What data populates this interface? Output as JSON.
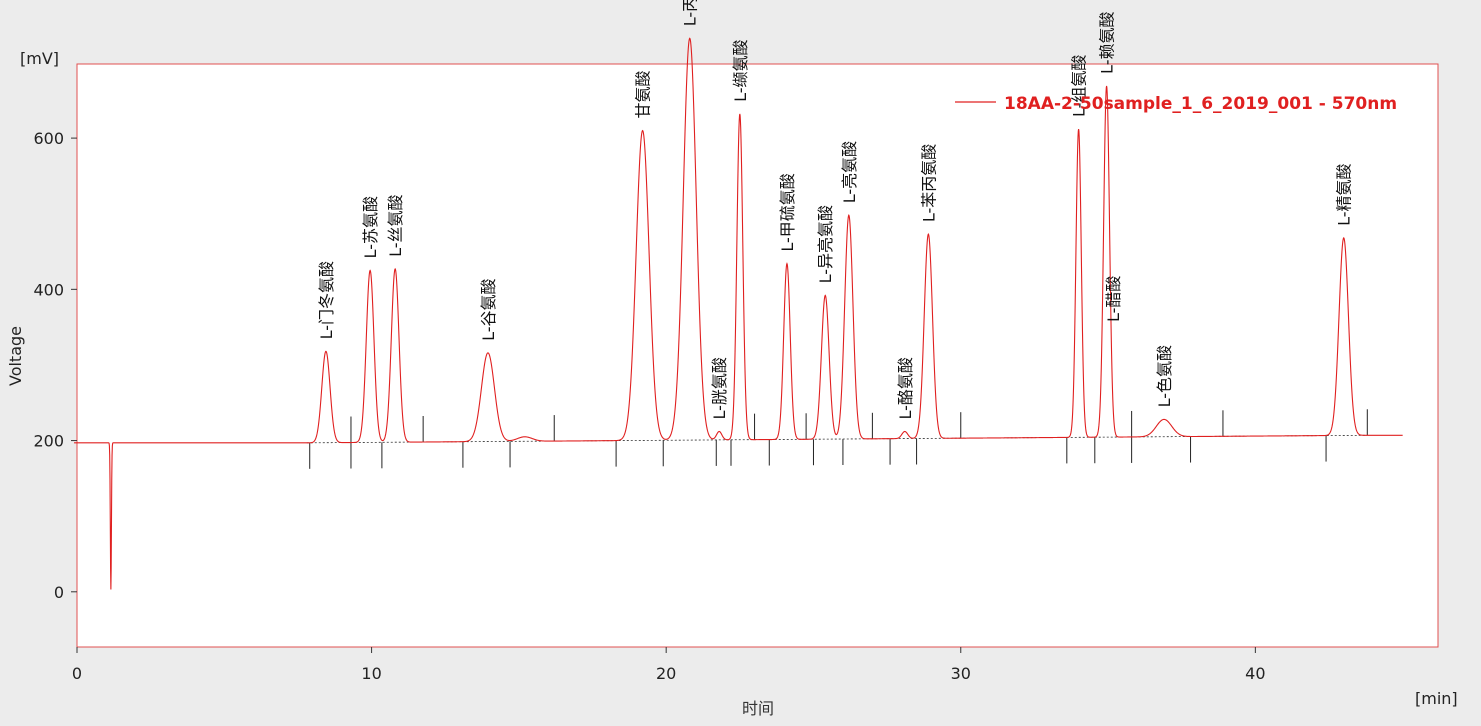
{
  "chart_data": {
    "type": "line",
    "y_unit": "[mV]",
    "ylabel": "Voltage",
    "x_unit": "[min]",
    "xlabel": "时间",
    "xlim": [
      0,
      46.2
    ],
    "ylim": [
      -73,
      698
    ],
    "x_ticks": [
      0,
      10,
      20,
      30,
      40
    ],
    "y_ticks": [
      0,
      200,
      400,
      600
    ],
    "legend_position": "top-right",
    "colors": {
      "trace": "#e02020",
      "frame": "#e05050",
      "baseline": "#333333"
    },
    "baseline": {
      "start": 197,
      "end": 207,
      "x_start": 7.8,
      "x_end": 43.8
    },
    "series": [
      {
        "name": "18AA-2-50sample_1_6_2019_001 - 570nm",
        "x_start": -0.1,
        "x_end": 45
      }
    ],
    "dip": {
      "x": 1.15,
      "y": 3
    },
    "peaks": [
      {
        "label": "L-门冬氨酸",
        "rt": 8.45,
        "height": 318,
        "sigma": 0.14
      },
      {
        "label": "L-苏氨酸",
        "rt": 9.95,
        "height": 425,
        "sigma": 0.13
      },
      {
        "label": "L-丝氨酸",
        "rt": 10.8,
        "height": 427,
        "sigma": 0.13
      },
      {
        "label": "L-谷氨酸",
        "rt": 13.95,
        "height": 316,
        "sigma": 0.22
      },
      {
        "label": "",
        "rt": 15.2,
        "height": 205,
        "sigma": 0.25
      },
      {
        "label": "甘氨酸",
        "rt": 19.2,
        "height": 610,
        "sigma": 0.22
      },
      {
        "label": "L-丙氨酸",
        "rt": 20.8,
        "height": 732,
        "sigma": 0.22
      },
      {
        "label": "L-胱氨酸",
        "rt": 21.8,
        "height": 212,
        "sigma": 0.09
      },
      {
        "label": "L-缬氨酸",
        "rt": 22.5,
        "height": 632,
        "sigma": 0.1
      },
      {
        "label": "L-甲硫氨酸",
        "rt": 24.1,
        "height": 434,
        "sigma": 0.11
      },
      {
        "label": "L-异亮氨酸",
        "rt": 25.4,
        "height": 392,
        "sigma": 0.13
      },
      {
        "label": "L-亮氨酸",
        "rt": 26.2,
        "height": 498,
        "sigma": 0.14
      },
      {
        "label": "L-酪氨酸",
        "rt": 28.1,
        "height": 212,
        "sigma": 0.1
      },
      {
        "label": "L-苯丙氨酸",
        "rt": 28.9,
        "height": 473,
        "sigma": 0.14
      },
      {
        "label": "L-组氨酸",
        "rt": 34.0,
        "height": 612,
        "sigma": 0.09
      },
      {
        "label": "L-赖氨酸",
        "rt": 34.95,
        "height": 669,
        "sigma": 0.1
      },
      {
        "label": "L-色氨酸",
        "rt": 36.9,
        "height": 228,
        "sigma": 0.26
      },
      {
        "label": "L-精氨酸",
        "rt": 43.0,
        "height": 468,
        "sigma": 0.16
      }
    ],
    "extra_labels": [
      {
        "text": "L-醋酸",
        "rt": 35.1
      }
    ],
    "integration_marks_below": [
      7.9,
      9.3,
      10.35,
      13.1,
      14.7,
      18.3,
      19.9,
      21.7,
      22.2,
      23.5,
      25.0,
      26.0,
      27.6,
      28.5,
      33.6,
      34.55,
      35.8,
      37.8,
      42.4
    ],
    "integration_marks_above": [
      9.3,
      11.75,
      16.2,
      23.0,
      24.75,
      27.0,
      30.0,
      35.8,
      38.9,
      43.8
    ]
  }
}
